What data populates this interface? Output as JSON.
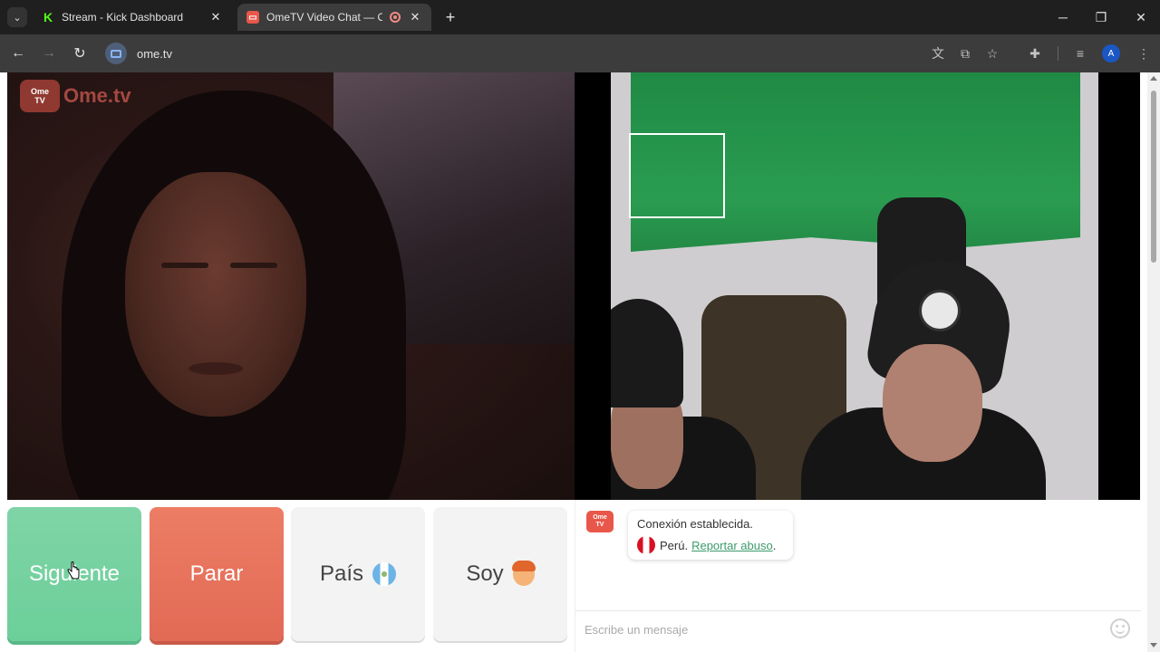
{
  "browser": {
    "tabs": [
      {
        "title": "Stream - Kick Dashboard",
        "favicon": "kick-logo-icon",
        "active": false
      },
      {
        "title": "OmeTV Video Chat — Ome",
        "favicon": "ometv-logo-icon",
        "active": true,
        "recording": true
      }
    ],
    "url": "ome.tv",
    "profile_initial": "A"
  },
  "logo": {
    "badge_top": "Ome",
    "badge_bottom": "TV",
    "text": "Ome.tv"
  },
  "controls": {
    "next_label": "Siguiente",
    "stop_label": "Parar",
    "country_label": "País",
    "country_flag": "guatemala-flag-icon",
    "gender_label": "Soy",
    "gender_icon": "boy-face-icon"
  },
  "chat": {
    "avatar_top": "Ome",
    "avatar_bottom": "TV",
    "status_message": "Conexión establecida.",
    "country": "Perú.",
    "country_flag": "peru-flag-icon",
    "report_link": "Reportar abuso",
    "report_suffix": ".",
    "input_placeholder": "Escribe un mensaje"
  },
  "colors": {
    "next_button": "#6ccf9a",
    "stop_button": "#e26a56",
    "brand": "#e8574a",
    "link": "#3c9b6a"
  }
}
